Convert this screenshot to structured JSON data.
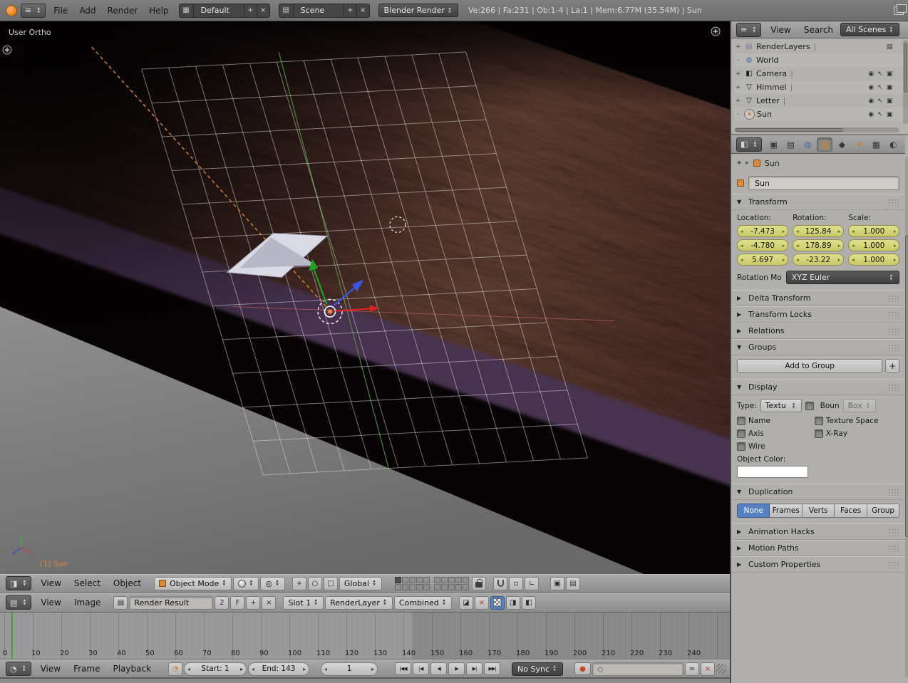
{
  "topbar": {
    "menus": [
      "File",
      "Add",
      "Render",
      "Help"
    ],
    "layout_name": "Default",
    "scene_name": "Scene",
    "engine": "Blender Render",
    "stats": "Ve:266 | Fa:231 | Ob:1-4 | La:1 | Mem:6.77M (35.54M) | Sun"
  },
  "viewport": {
    "view_label": "User Ortho",
    "active_object": "(1) Sun"
  },
  "view3d_header": {
    "menus": [
      "View",
      "Select",
      "Object"
    ],
    "mode": "Object Mode",
    "orientation": "Global"
  },
  "uv_header": {
    "menus": [
      "View",
      "Image"
    ],
    "image_name": "Render Result",
    "users_count": "2",
    "fake_user": "F",
    "slot": "Slot 1",
    "render_layer": "RenderLayer",
    "render_pass": "Combined"
  },
  "timeline": {
    "menus": [
      "View",
      "Frame",
      "Playback"
    ],
    "start": "Start: 1",
    "end": "End: 143",
    "current_frame": "1",
    "sync_mode": "No Sync",
    "ticks": [
      "0",
      "10",
      "20",
      "30",
      "40",
      "50",
      "60",
      "70",
      "80",
      "90",
      "100",
      "110",
      "120",
      "130",
      "140",
      "150",
      "160",
      "170",
      "180",
      "190",
      "200",
      "210",
      "220",
      "230",
      "240"
    ]
  },
  "outliner": {
    "menus": [
      "View",
      "Search"
    ],
    "scope": "All Scenes",
    "items": [
      "RenderLayers",
      "World",
      "Camera",
      "Himmel",
      "Letter",
      "Sun"
    ]
  },
  "properties": {
    "breadcrumb_object": "Sun",
    "object_name": "Sun",
    "transform": {
      "title": "Transform",
      "columns": [
        "Location:",
        "Rotation:",
        "Scale:"
      ],
      "location": [
        "-7.473",
        "-4.780",
        "5.697"
      ],
      "rotation": [
        "125.84",
        "178.89",
        "-23.22"
      ],
      "scale": [
        "1.000",
        "1.000",
        "1.000"
      ],
      "rotation_mode_label": "Rotation Mo",
      "rotation_mode": "XYZ Euler"
    },
    "panels": {
      "delta_transform": "Delta Transform",
      "transform_locks": "Transform Locks",
      "relations": "Relations",
      "groups": "Groups",
      "display": "Display",
      "duplication": "Duplication",
      "animation_hacks": "Animation Hacks",
      "motion_paths": "Motion Paths",
      "custom_properties": "Custom Properties"
    },
    "groups_panel": {
      "add_to_group": "Add to Group"
    },
    "display_panel": {
      "type_label": "Type:",
      "type_value": "Textu",
      "bounds": "Boun",
      "bounds_type": "Box",
      "name": "Name",
      "texture_space": "Texture Space",
      "axis": "Axis",
      "xray": "X-Ray",
      "wire": "Wire",
      "object_color_label": "Object Color:"
    },
    "duplication_panel": {
      "options": [
        "None",
        "Frames",
        "Verts",
        "Faces",
        "Group"
      ],
      "active": "None"
    }
  }
}
